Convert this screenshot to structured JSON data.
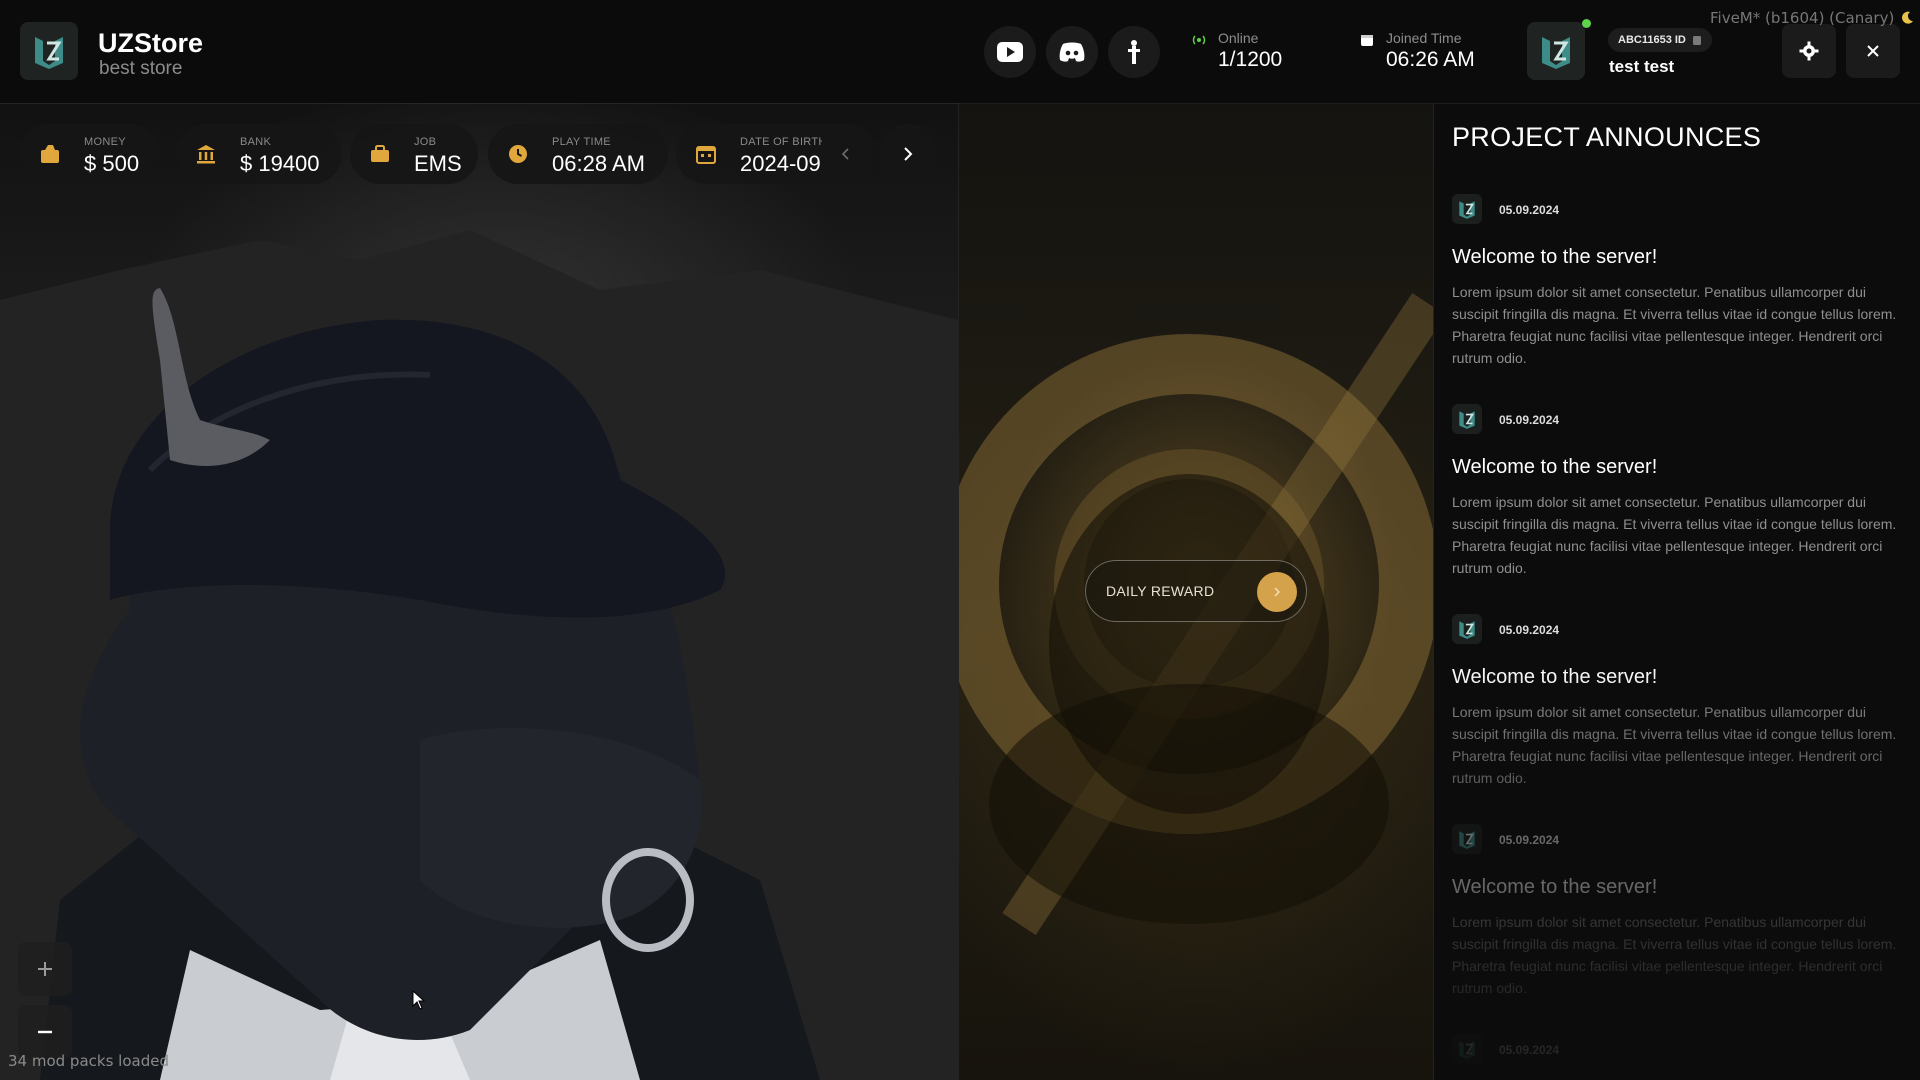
{
  "brand": {
    "title": "UZStore",
    "subtitle": "best store"
  },
  "topbar": {
    "online": {
      "label": "Online",
      "value": "1/1200"
    },
    "joined": {
      "label": "Joined Time",
      "value": "06:26 AM"
    },
    "user": {
      "id_label": "ABC11653 ID",
      "name": "test test",
      "status_color": "#5fd34a"
    },
    "social_icons": [
      "youtube-icon",
      "discord-icon",
      "tiktok-icon"
    ],
    "fivem_label": "FiveM* (b1604) (Canary)"
  },
  "stats": {
    "money": {
      "label": "MONEY",
      "value": "$ 500"
    },
    "bank": {
      "label": "BANK",
      "value": "$ 19400"
    },
    "job": {
      "label": "JOB",
      "value": "EMS"
    },
    "playtime": {
      "label": "PLAY TIME",
      "value": "06:28 AM"
    },
    "dob": {
      "label": "DATE OF BIRTH",
      "value": "2024-09"
    }
  },
  "reward": {
    "label": "DAILY REWARD",
    "accent": "#d4a24a"
  },
  "footer": {
    "mod_text": "34 mod packs loaded"
  },
  "announcements": {
    "title": "PROJECT ANNOUNCES",
    "items": [
      {
        "date": "05.09.2024",
        "heading": "Welcome to the server!",
        "body": "Lorem ipsum dolor sit amet consectetur. Penatibus ullamcorper dui suscipit fringilla dis magna. Et viverra tellus vitae id congue tellus lorem. Pharetra feugiat nunc facilisi vitae pellentesque integer. Hendrerit orci rutrum odio."
      },
      {
        "date": "05.09.2024",
        "heading": "Welcome to the server!",
        "body": "Lorem ipsum dolor sit amet consectetur. Penatibus ullamcorper dui suscipit fringilla dis magna. Et viverra tellus vitae id congue tellus lorem. Pharetra feugiat nunc facilisi vitae pellentesque integer. Hendrerit orci rutrum odio."
      },
      {
        "date": "05.09.2024",
        "heading": "Welcome to the server!",
        "body": "Lorem ipsum dolor sit amet consectetur. Penatibus ullamcorper dui suscipit fringilla dis magna. Et viverra tellus vitae id congue tellus lorem. Pharetra feugiat nunc facilisi vitae pellentesque integer. Hendrerit orci rutrum odio."
      },
      {
        "date": "05.09.2024",
        "heading": "Welcome to the server!",
        "body": "Lorem ipsum dolor sit amet consectetur. Penatibus ullamcorper dui suscipit fringilla dis magna. Et viverra tellus vitae id congue tellus lorem. Pharetra feugiat nunc facilisi vitae pellentesque integer. Hendrerit orci rutrum odio."
      },
      {
        "date": "05.09.2024"
      }
    ]
  }
}
